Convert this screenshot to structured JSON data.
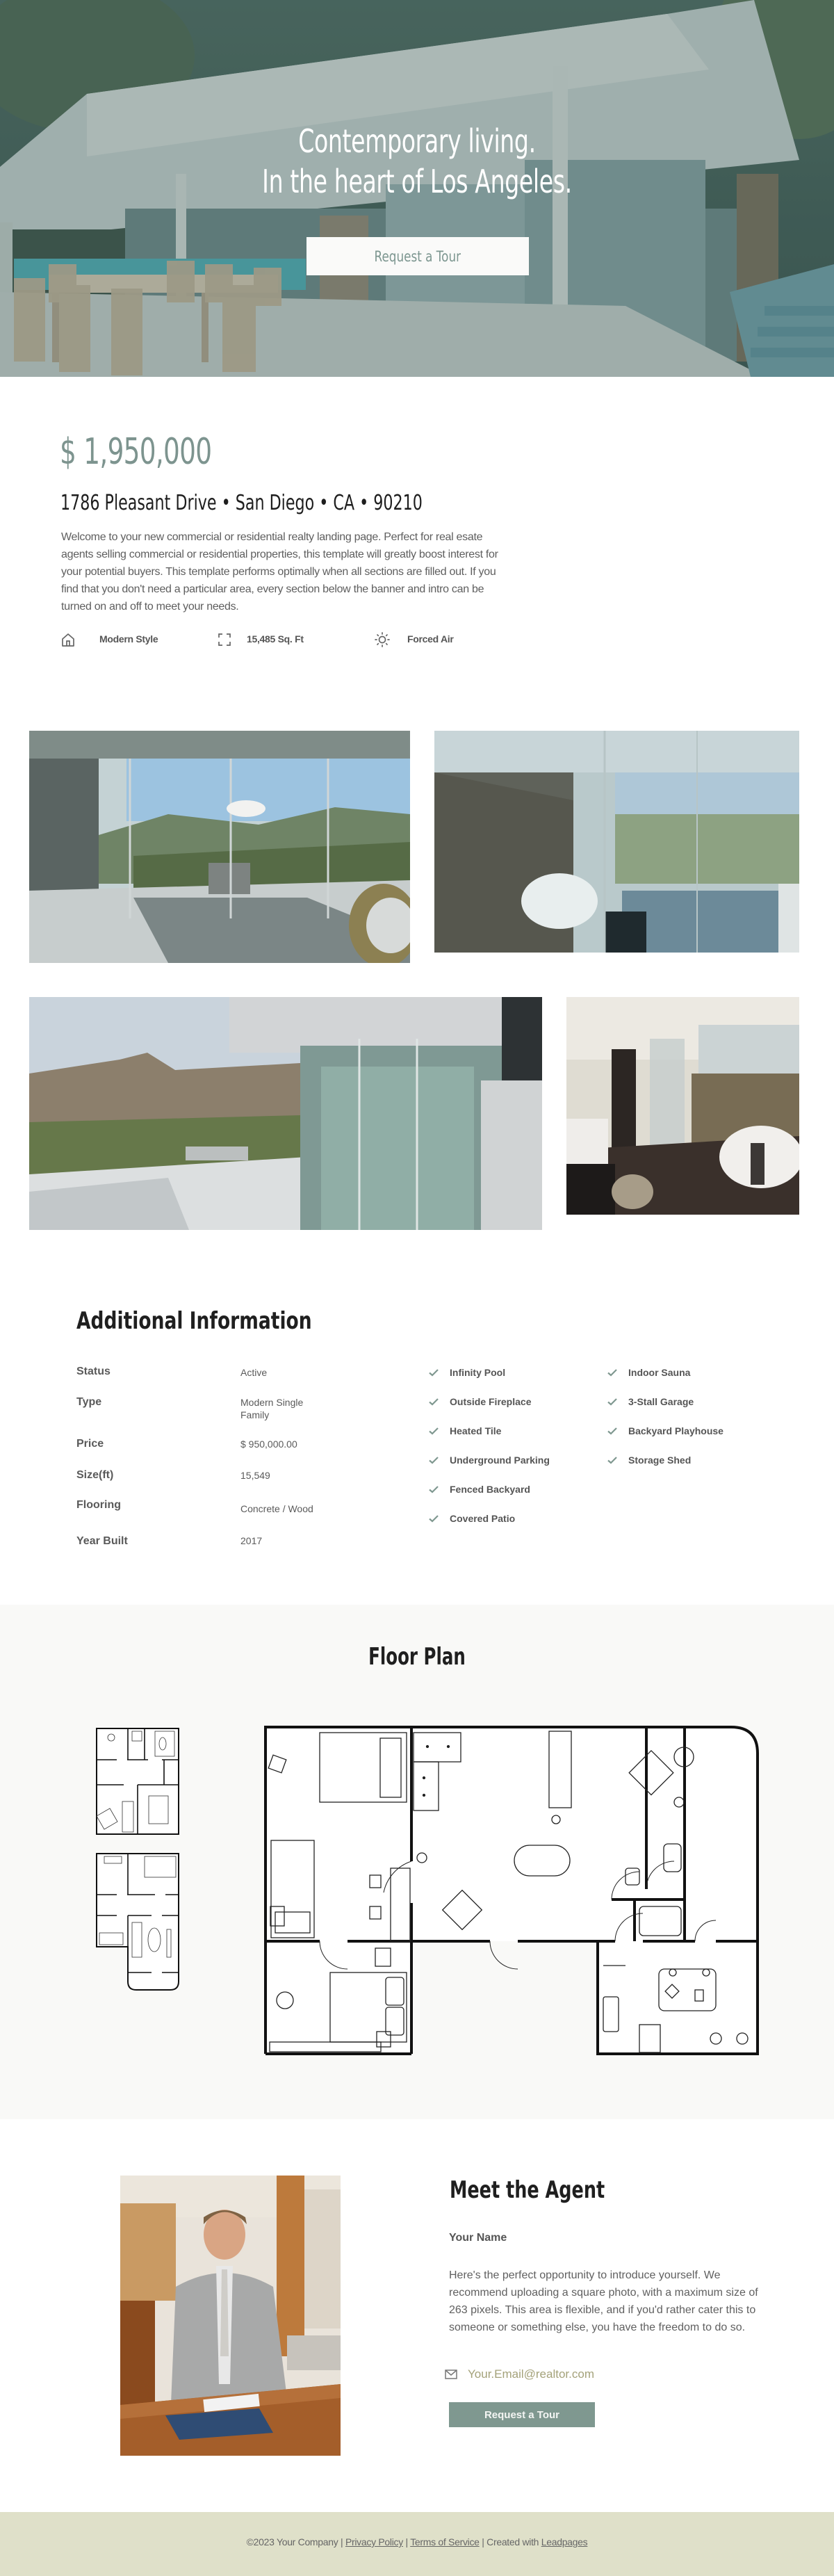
{
  "hero": {
    "title_line1": "Contemporary living.",
    "title_line2": "In the heart of Los Angeles.",
    "cta_label": "Request a Tour"
  },
  "intro": {
    "price": "$ 1,950,000",
    "address": "1786 Pleasant Drive • San Diego • CA • 90210",
    "description": "Welcome to your new commercial or residential realty landing page. Perfect for real esate agents selling commercial or residential properties, this template will greatly boost interest for your potential buyers. This template performs optimally when all sections are filled out. If you find that you don't need a particular area, every section below the banner and intro can be turned on and off to meet your needs.",
    "features": [
      {
        "icon": "home-icon",
        "label": "Modern Style"
      },
      {
        "icon": "expand-icon",
        "label": "15,485 Sq. Ft"
      },
      {
        "icon": "sun-icon",
        "label": "Forced Air"
      }
    ]
  },
  "gallery": {
    "images": [
      {
        "alt": "Living room with mountain view"
      },
      {
        "alt": "Bathroom with freestanding tub"
      },
      {
        "alt": "Exterior glass walls and terrace"
      },
      {
        "alt": "Master bathroom"
      }
    ]
  },
  "additional_info": {
    "title": "Additional Information",
    "details": [
      {
        "key": "Status",
        "value": "Active"
      },
      {
        "key": "Type",
        "value": "Modern Single Family"
      },
      {
        "key": "Price",
        "value": "$ 950,000.00"
      },
      {
        "key": "Size(ft)",
        "value": "15,549"
      },
      {
        "key": "Flooring",
        "value": "Concrete / Wood"
      },
      {
        "key": "Year Built",
        "value": "2017"
      }
    ],
    "amenities_col1": [
      "Infinity Pool",
      "Outside Fireplace",
      "Heated Tile",
      "Underground Parking",
      "Fenced Backyard",
      "Covered Patio"
    ],
    "amenities_col2": [
      "Indoor Sauna",
      "3-Stall Garage",
      "Backyard Playhouse",
      "Storage Shed"
    ]
  },
  "floor_plan": {
    "title": "Floor Plan"
  },
  "agent": {
    "title": "Meet the Agent",
    "name": "Your Name",
    "bio": "Here's the perfect opportunity to introduce yourself. We recommend uploading a square photo, with a maximum size of 263 pixels. This area is flexible, and if you'd rather cater this to someone or something else, you have the freedom to do so.",
    "email": "Your.Email@realtor.com",
    "cta_label": "Request a Tour"
  },
  "footer": {
    "copyright": "©2023 Your Company |",
    "privacy": "Privacy Policy",
    "sep1": "|",
    "terms": "Terms of Service",
    "created": "| Created with",
    "leadpages": "Leadpages"
  },
  "colors": {
    "accent": "#7f9890",
    "price": "#7d948f",
    "email": "#a4a27a",
    "footer_bg": "#dfe0c9",
    "section_bg": "#f9f9f7"
  }
}
